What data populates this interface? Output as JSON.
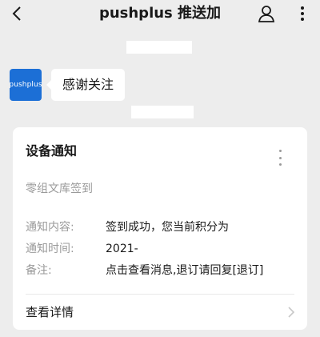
{
  "header": {
    "title": "pushplus 推送加"
  },
  "chat": {
    "avatar_text": "pushplus",
    "message": "感谢关注"
  },
  "card": {
    "title": "设备通知",
    "subtitle": "零组文库签到",
    "rows": [
      {
        "label": "通知内容:",
        "value": "签到成功，您当前积分为"
      },
      {
        "label": "通知时间:",
        "value": "2021-"
      },
      {
        "label": "备注:",
        "value": "点击查看消息,退订请回复[退订]"
      }
    ],
    "footer_label": "查看详情"
  },
  "colors": {
    "background": "#ededed",
    "avatar": "#1c6fd6",
    "muted_text": "#9a9a9a"
  },
  "icons": {
    "back": "chevron-left-icon",
    "profile": "person-icon",
    "more": "more-vertical-icon",
    "card_menu": "more-vertical-icon",
    "footer": "chevron-right-icon"
  }
}
